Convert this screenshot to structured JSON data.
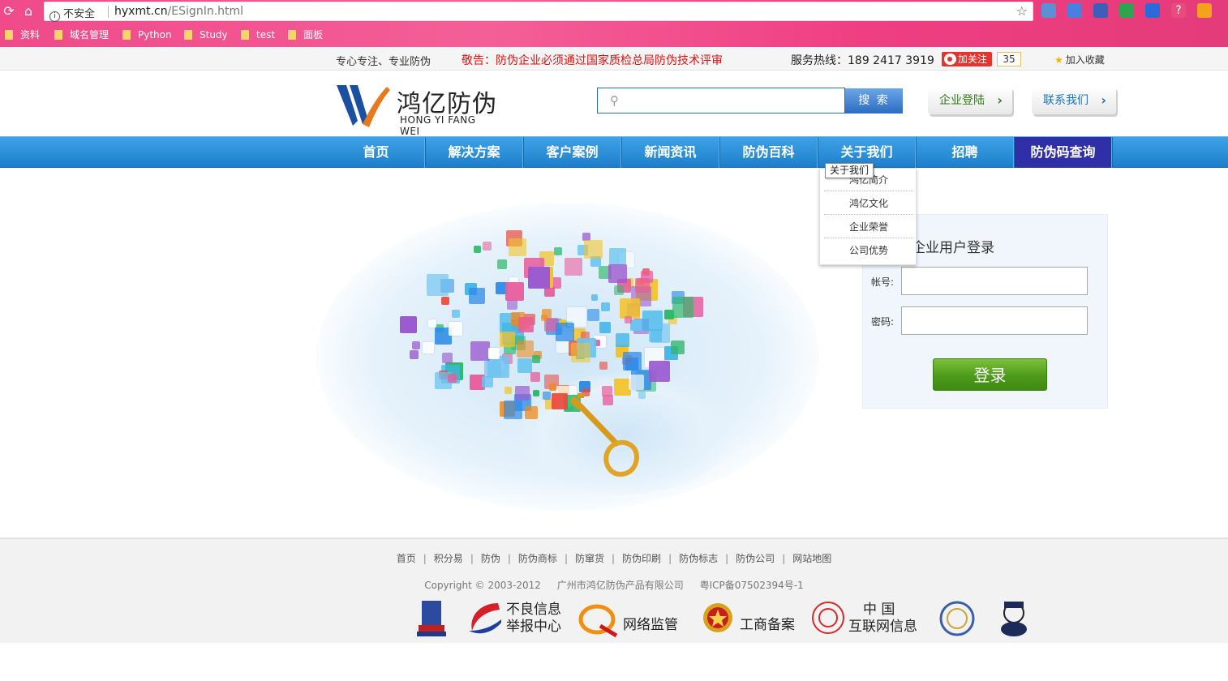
{
  "browser": {
    "secure_label": "不安全",
    "url_host": "hyxmt.cn",
    "url_path": "/ESignIn.html",
    "bookmarks": [
      "资料",
      "域名管理",
      "Python",
      "Study",
      "test",
      "面板"
    ]
  },
  "topbar": {
    "slogan": "专心专注、专业防伪",
    "notice": "敬告：防伪企业必须通过国家质检总局防伪技术评审",
    "hotline": "服务热线：189 2417 3919",
    "follow_label": "加关注",
    "follow_count": "35",
    "favorite_label": "加入收藏"
  },
  "header": {
    "logo_cn": "鸿亿防伪",
    "logo_en": "HONG YI FANG WEI",
    "search_button": "搜 索",
    "enterprise_login": "企业登陆",
    "contact_us": "联系我们"
  },
  "nav": {
    "items": [
      "首页",
      "解决方案",
      "客户案例",
      "新闻资讯",
      "防伪百科",
      "关于我们",
      "招聘",
      "防伪码查询"
    ],
    "tooltip": "关于我们",
    "dropdown": [
      "鸿亿简介",
      "鸿亿文化",
      "企业荣誉",
      "公司优势"
    ]
  },
  "login": {
    "title": "企业用户登录",
    "account_label": "帐号:",
    "password_label": "密码:",
    "submit": "登录"
  },
  "footer": {
    "links": [
      "首页",
      "积分易",
      "防伪",
      "防伪商标",
      "防窜货",
      "防伪印刷",
      "防伪标志",
      "防伪公司",
      "网站地图"
    ],
    "copyright": "Copyright © 2003-2012",
    "company": "广州市鸿亿防伪产品有限公司",
    "icp": "粤ICP备07502394号-1",
    "badges": {
      "report_line1": "不良信息",
      "report_line2": "举报中心",
      "monitor": "网络监管",
      "registry": "工商备案",
      "china_line1": "中 国",
      "china_line2": "互联网信息"
    }
  },
  "colors": {
    "chrome": "#f04a8a",
    "nav": "#1d7fcb",
    "nav_active": "#2f2fa7",
    "notice": "#dd1111",
    "login_button": "#4d9a1b"
  }
}
